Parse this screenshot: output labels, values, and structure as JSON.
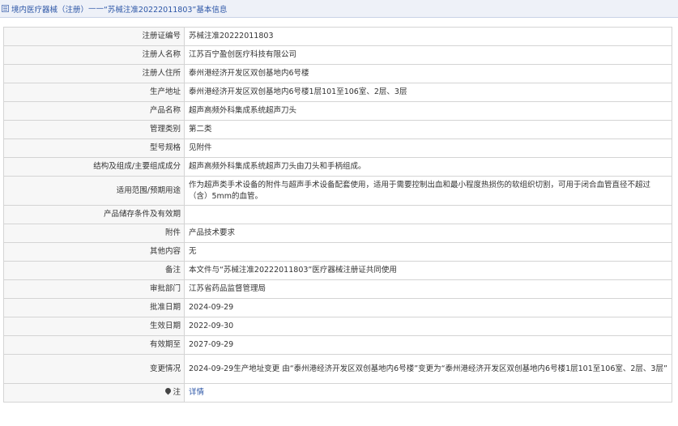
{
  "header": {
    "crumb": "境内医疗器械（注册）",
    "sep": "——",
    "title": "“苏械注准20222011803”基本信息"
  },
  "rows": [
    {
      "label": "注册证编号",
      "value": "苏械注准20222011803"
    },
    {
      "label": "注册人名称",
      "value": "江苏百宁盈创医疗科技有限公司"
    },
    {
      "label": "注册人住所",
      "value": "泰州港经济开发区双创基地内6号楼"
    },
    {
      "label": "生产地址",
      "value": "泰州港经济开发区双创基地内6号楼1层101至106室、2层、3层"
    },
    {
      "label": "产品名称",
      "value": "超声高频外科集成系统超声刀头"
    },
    {
      "label": "管理类别",
      "value": "第二类"
    },
    {
      "label": "型号规格",
      "value": "见附件"
    },
    {
      "label": "结构及组成/主要组成成分",
      "value": "超声高频外科集成系统超声刀头由刀头和手柄组成。"
    },
    {
      "label": "适用范围/预期用途",
      "value": "作为超声类手术设备的附件与超声手术设备配套使用，适用于需要控制出血和最小程度热损伤的软组织切割，可用于闭合血管直径不超过（含）5mm的血管。"
    },
    {
      "label": "产品储存条件及有效期",
      "value": ""
    },
    {
      "label": "附件",
      "value": "产品技术要求"
    },
    {
      "label": "其他内容",
      "value": "无"
    },
    {
      "label": "备注",
      "value": "本文件与“苏械注准20222011803”医疗器械注册证共同使用"
    },
    {
      "label": "审批部门",
      "value": "江苏省药品监督管理局"
    },
    {
      "label": "批准日期",
      "value": "2024-09-29"
    },
    {
      "label": "生效日期",
      "value": "2022-09-30"
    },
    {
      "label": "有效期至",
      "value": "2027-09-29"
    },
    {
      "label": "变更情况",
      "value": "2024-09-29生产地址变更 由“泰州港经济开发区双创基地内6号楼”变更为“泰州港经济开发区双创基地内6号楼1层101至106室、2层、3层”"
    }
  ],
  "note_row": {
    "label": "注",
    "link": "详情",
    "icon": "pin-icon"
  }
}
